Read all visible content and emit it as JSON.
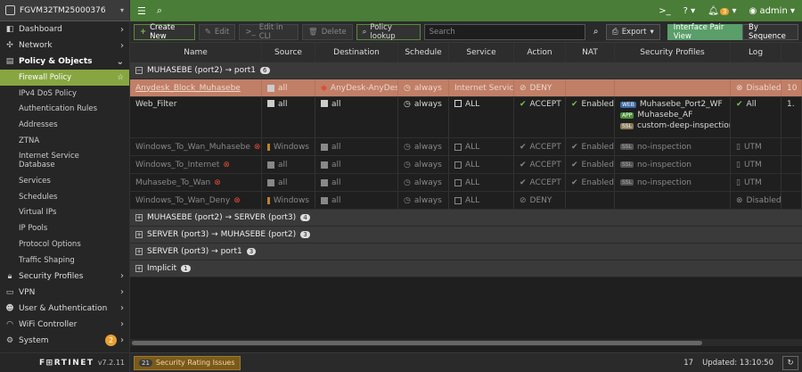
{
  "device": {
    "name": "FGVM32TM25000376"
  },
  "sidebar": {
    "items": [
      {
        "label": "Dashboard",
        "icon": "dashboard-icon"
      },
      {
        "label": "Network",
        "icon": "network-icon"
      },
      {
        "label": "Policy & Objects",
        "icon": "policy-icon"
      }
    ],
    "policy_sub": [
      {
        "label": "Firewall Policy"
      },
      {
        "label": "IPv4 DoS Policy"
      },
      {
        "label": "Authentication Rules"
      },
      {
        "label": "Addresses"
      },
      {
        "label": "ZTNA"
      },
      {
        "label": "Internet Service Database"
      },
      {
        "label": "Services"
      },
      {
        "label": "Schedules"
      },
      {
        "label": "Virtual IPs"
      },
      {
        "label": "IP Pools"
      },
      {
        "label": "Protocol Options"
      },
      {
        "label": "Traffic Shaping"
      }
    ],
    "bottom_items": [
      {
        "label": "Security Profiles"
      },
      {
        "label": "VPN"
      },
      {
        "label": "User & Authentication"
      },
      {
        "label": "WiFi Controller"
      },
      {
        "label": "System",
        "badge": "2"
      }
    ],
    "logo": "F⊞RTINET",
    "version": "v7.2.11"
  },
  "topbar": {
    "notif_count": "3",
    "user": "admin"
  },
  "toolbar": {
    "create_new": "Create New",
    "edit": "Edit",
    "edit_cli": "Edit in CLI",
    "delete": "Delete",
    "policy_lookup": "Policy lookup",
    "search_placeholder": "Search",
    "export": "Export",
    "view_interface_pair": "Interface Pair View",
    "view_sequence": "By Sequence"
  },
  "columns": [
    "Name",
    "Source",
    "Destination",
    "Schedule",
    "Service",
    "Action",
    "NAT",
    "Security Profiles",
    "Log"
  ],
  "groups": [
    {
      "label": "MUHASEBE (port2) → port1",
      "count": "6"
    },
    {
      "label": "MUHASEBE (port2) → SERVER (port3)",
      "count": "4"
    },
    {
      "label": "SERVER (port3) → MUHASEBE (port2)",
      "count": "3"
    },
    {
      "label": "SERVER (port3) → port1",
      "count": "3"
    },
    {
      "label": "Implicit",
      "count": "1"
    }
  ],
  "policies": [
    {
      "name": "Anydesk_Block_Muhasebe",
      "src": "all",
      "dst": "AnyDesk-AnyDesk",
      "sch": "always",
      "svc": "Internet Service",
      "act": "DENY",
      "nat": "",
      "prof": "",
      "log": "Disabled",
      "extra": "10"
    },
    {
      "name": "Web_Filter",
      "src": "all",
      "dst": "all",
      "sch": "always",
      "svc": "ALL",
      "act": "ACCEPT",
      "nat": "Enabled",
      "prof1": "Muhasebe_Port2_WF",
      "prof2": "Muhasebe_AF",
      "prof3": "custom-deep-inspection",
      "log": "All",
      "extra": "1."
    },
    {
      "name": "Windows_To_Wan_Muhasebe",
      "src": "Windows",
      "dst": "all",
      "sch": "always",
      "svc": "ALL",
      "act": "ACCEPT",
      "nat": "Enabled",
      "prof": "no-inspection",
      "log": "UTM"
    },
    {
      "name": "Windows_To_Internet",
      "src": "all",
      "dst": "all",
      "sch": "always",
      "svc": "ALL",
      "act": "ACCEPT",
      "nat": "Enabled",
      "prof": "no-inspection",
      "log": "UTM"
    },
    {
      "name": "Muhasebe_To_Wan",
      "src": "all",
      "dst": "all",
      "sch": "always",
      "svc": "ALL",
      "act": "ACCEPT",
      "nat": "Enabled",
      "prof": "no-inspection",
      "log": "UTM"
    },
    {
      "name": "Windows_To_Wan_Deny",
      "src": "Windows",
      "dst": "all",
      "sch": "always",
      "svc": "ALL",
      "act": "DENY",
      "nat": "",
      "prof": "",
      "log": "Disabled"
    }
  ],
  "tags": {
    "web": "WEB",
    "app": "APP",
    "ssl": "SSL"
  },
  "status": {
    "sec_count": "21",
    "sec_label": "Security Rating Issues",
    "total": "17",
    "updated": "Updated: 13:10:50"
  }
}
